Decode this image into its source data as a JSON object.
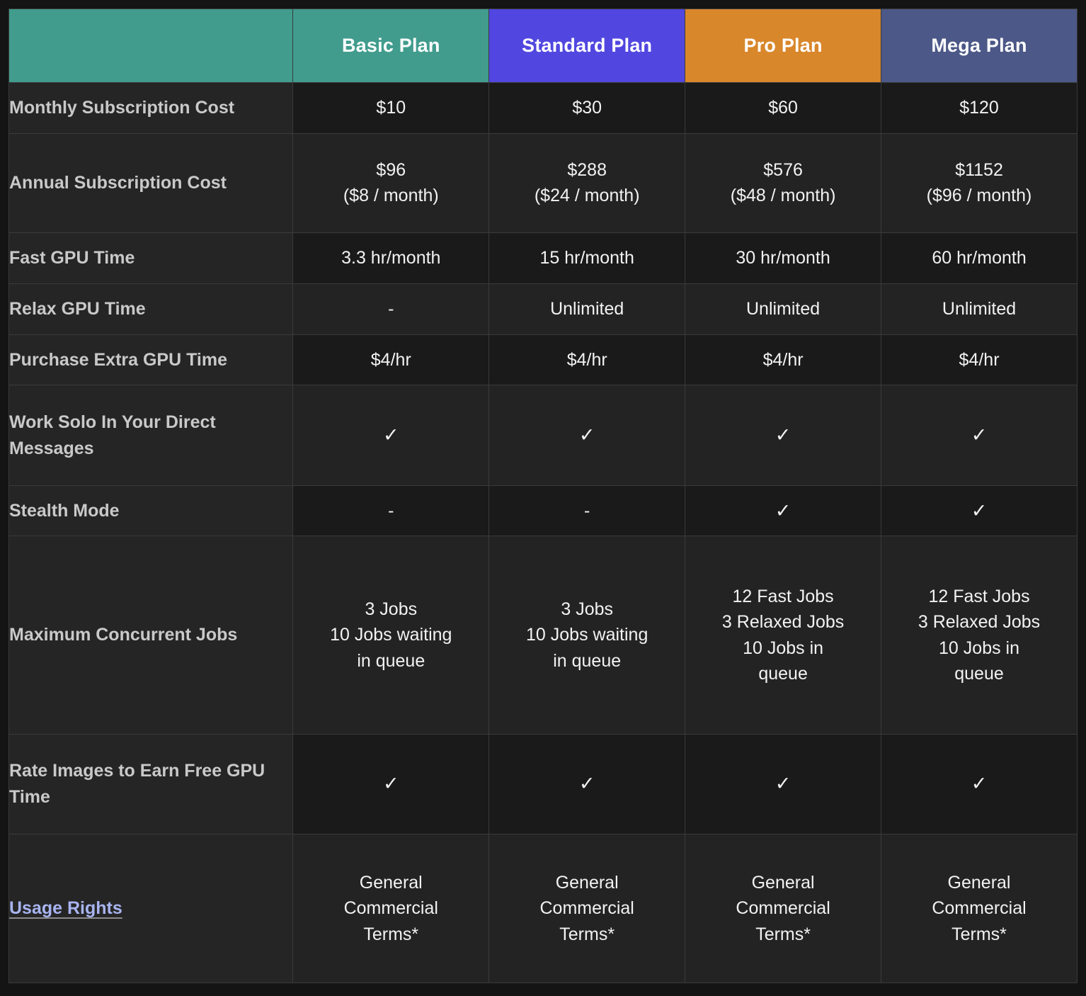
{
  "table": {
    "columns": [
      {
        "key": "label",
        "label": "",
        "header_color": "#419c8d"
      },
      {
        "key": "basic",
        "label": "Basic Plan",
        "header_color": "#419c8d"
      },
      {
        "key": "standard",
        "label": "Standard Plan",
        "header_color": "#5147e0"
      },
      {
        "key": "pro",
        "label": "Pro Plan",
        "header_color": "#d9872b"
      },
      {
        "key": "mega",
        "label": "Mega Plan",
        "header_color": "#4c5887"
      }
    ],
    "rows": [
      {
        "label": "Monthly Subscription Cost",
        "basic": [
          "$10"
        ],
        "standard": [
          "$30"
        ],
        "pro": [
          "$60"
        ],
        "mega": [
          "$120"
        ]
      },
      {
        "label": "Annual Subscription Cost",
        "basic": [
          "$96",
          "($8 / month)"
        ],
        "standard": [
          "$288",
          "($24 / month)"
        ],
        "pro": [
          "$576",
          "($48 / month)"
        ],
        "mega": [
          "$1152",
          "($96 / month)"
        ]
      },
      {
        "label": "Fast GPU Time",
        "basic": [
          "3.3 hr/month"
        ],
        "standard": [
          "15 hr/month"
        ],
        "pro": [
          "30 hr/month"
        ],
        "mega": [
          "60 hr/month"
        ]
      },
      {
        "label": "Relax GPU Time",
        "basic": [
          "-"
        ],
        "standard": [
          "Unlimited"
        ],
        "pro": [
          "Unlimited"
        ],
        "mega": [
          "Unlimited"
        ]
      },
      {
        "label": "Purchase Extra GPU Time",
        "basic": [
          "$4/hr"
        ],
        "standard": [
          "$4/hr"
        ],
        "pro": [
          "$4/hr"
        ],
        "mega": [
          "$4/hr"
        ]
      },
      {
        "label": "Work Solo In Your Direct Messages",
        "basic": [
          "✓"
        ],
        "standard": [
          "✓"
        ],
        "pro": [
          "✓"
        ],
        "mega": [
          "✓"
        ]
      },
      {
        "label": "Stealth Mode",
        "basic": [
          "-"
        ],
        "standard": [
          "-"
        ],
        "pro": [
          "✓"
        ],
        "mega": [
          "✓"
        ]
      },
      {
        "label": "Maximum Concurrent Jobs",
        "basic": [
          "3 Jobs",
          "10 Jobs waiting",
          "in queue"
        ],
        "standard": [
          "3 Jobs",
          "10 Jobs waiting",
          "in queue"
        ],
        "pro": [
          "12 Fast Jobs",
          "3 Relaxed Jobs",
          "10 Jobs in",
          "queue"
        ],
        "mega": [
          "12 Fast Jobs",
          "3 Relaxed Jobs",
          "10 Jobs in",
          "queue"
        ]
      },
      {
        "label": "Rate Images to Earn Free GPU Time",
        "basic": [
          "✓"
        ],
        "standard": [
          "✓"
        ],
        "pro": [
          "✓"
        ],
        "mega": [
          "✓"
        ]
      },
      {
        "label": "Usage Rights",
        "label_is_link": true,
        "basic": [
          "General",
          "Commercial",
          "Terms*"
        ],
        "standard": [
          "General",
          "Commercial",
          "Terms*"
        ],
        "pro": [
          "General",
          "Commercial",
          "Terms*"
        ],
        "mega": [
          "General",
          "Commercial",
          "Terms*"
        ]
      }
    ]
  },
  "colors": {
    "page_background": "#141414",
    "table_background": "#1a1a1a",
    "row_odd": "#1a1a1a",
    "row_even": "#232323",
    "label_column": "#252525",
    "border": "#3a3a3a",
    "label_text": "#c9c9c9",
    "value_text": "#f2f2f2",
    "link_text": "#a8b4f0",
    "header_text": "#ffffff"
  },
  "glyphs": {
    "check": "✓",
    "dash": "-"
  }
}
